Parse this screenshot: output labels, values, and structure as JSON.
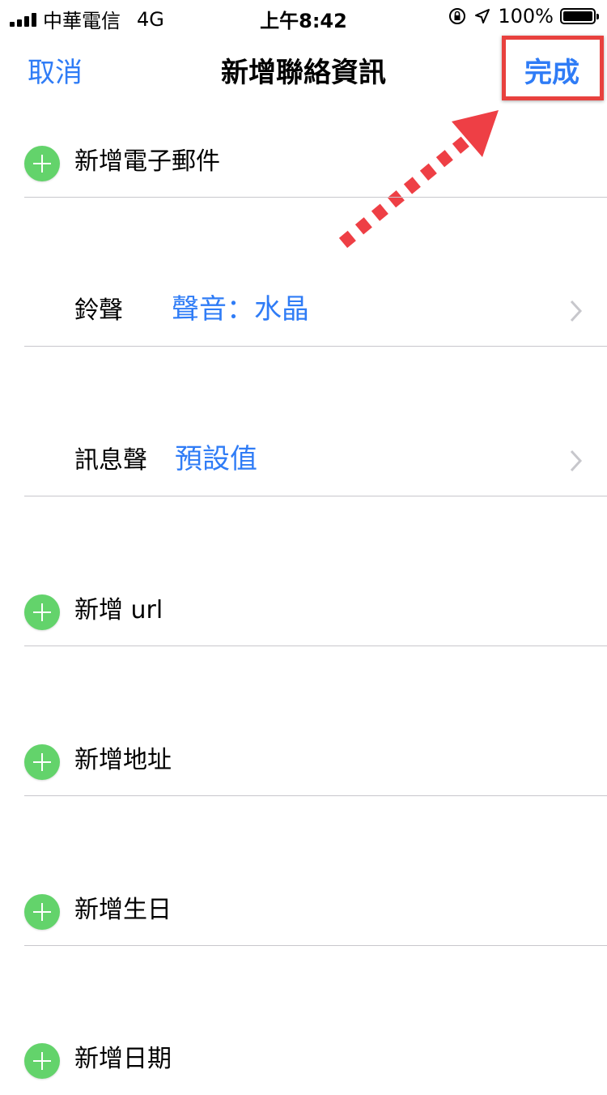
{
  "status_bar": {
    "carrier": "中華電信",
    "network": "4G",
    "time": "上午8:42",
    "battery": "100%",
    "icons": [
      "signal-icon",
      "orientation-lock-icon",
      "location-icon",
      "battery-icon"
    ]
  },
  "nav": {
    "cancel": "取消",
    "title": "新增聯絡資訊",
    "done": "完成"
  },
  "rows": {
    "add_email": "新增電子郵件",
    "ringtone_key": "鈴聲",
    "ringtone_value": "聲音：水晶",
    "text_tone_key": "訊息聲",
    "text_tone_value": "預設值",
    "add_url": "新增 url",
    "add_address": "新增地址",
    "add_birthday": "新增生日",
    "add_date": "新增日期"
  },
  "colors": {
    "accent": "#2f7cf6",
    "add_green": "#63d36b",
    "highlight_red": "#e8413e",
    "separator": "#c8c7cc"
  }
}
